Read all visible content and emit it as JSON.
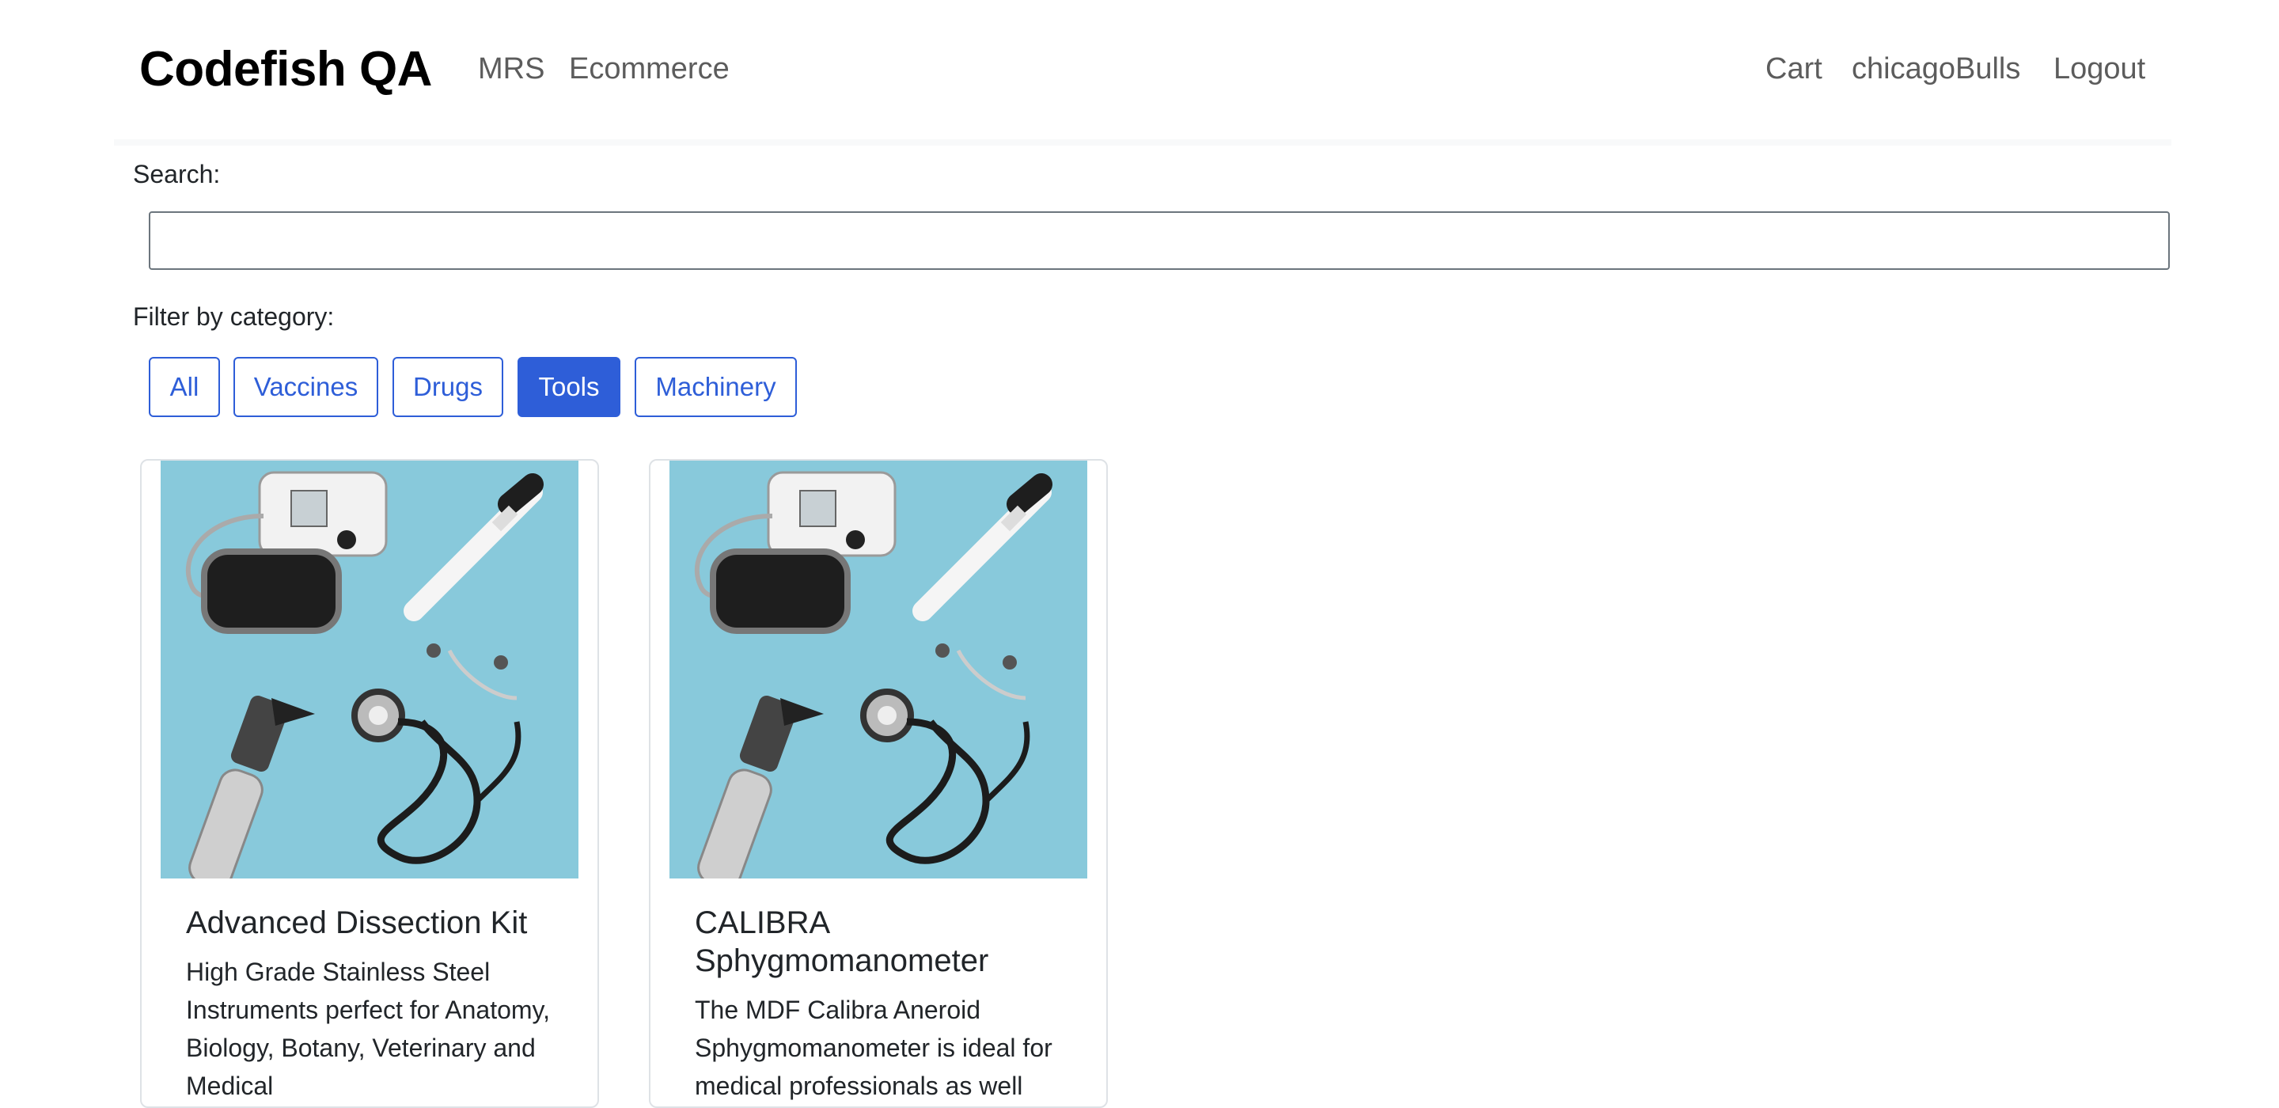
{
  "navbar": {
    "brand": "Codefish QA",
    "links": [
      "MRS",
      "Ecommerce"
    ],
    "right_links": [
      "Cart",
      "chicagoBulls",
      "Logout"
    ]
  },
  "search": {
    "label": "Search:",
    "value": "",
    "placeholder": ""
  },
  "filter": {
    "label": "Filter by category:",
    "categories": [
      "All",
      "Vaccines",
      "Drugs",
      "Tools",
      "Machinery"
    ],
    "active": "Tools"
  },
  "products": [
    {
      "title": "Advanced Dissection Kit",
      "description": "High Grade Stainless Steel Instruments perfect for Anatomy, Biology, Botany, Veterinary and Medical",
      "image_icon": "medical-tools-image"
    },
    {
      "title": "CALIBRA Sphygmomanometer",
      "description": "The MDF Calibra Aneroid Sphygmomanometer is ideal for medical professionals as well",
      "image_icon": "medical-tools-image"
    }
  ],
  "colors": {
    "primary": "#2e5ed8",
    "image_bg": "#88c9db"
  }
}
